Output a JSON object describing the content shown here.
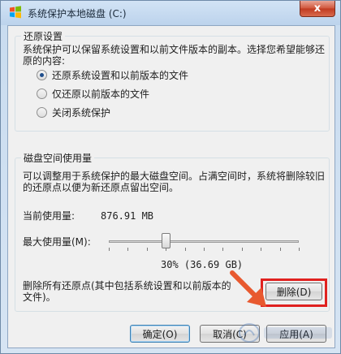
{
  "window": {
    "title": "系统保护本地磁盘 (C:)",
    "close_label": "x"
  },
  "restore": {
    "group_title": "还原设置",
    "description": "系统保护可以保留系统设置和以前文件版本的副本。选择您希望能够还原的内容:",
    "options": [
      {
        "label": "还原系统设置和以前版本的文件",
        "checked": true
      },
      {
        "label": "仅还原以前版本的文件",
        "checked": false
      },
      {
        "label": "关闭系统保护",
        "checked": false
      }
    ]
  },
  "disk": {
    "group_title": "磁盘空间使用量",
    "description": "可以调整用于系统保护的最大磁盘空间。占满空间时，系统将删除较旧的还原点以便为新还原点留出空间。",
    "current_label": "当前使用量:",
    "current_value": "876.91 MB",
    "max_label": "最大使用量(M):",
    "slider_fraction": 0.3,
    "slider_value_text": "30% (36.69 GB)",
    "delete_text": "删除所有还原点(其中包括系统设置和以前版本的文件)。",
    "delete_button": "删除(D)"
  },
  "footer": {
    "ok_button": "确定(O)",
    "cancel_button": "取消(C)",
    "apply_button": "应用(A)"
  },
  "colors": {
    "highlight": "#e0211f",
    "arrow": "#e8592f"
  }
}
